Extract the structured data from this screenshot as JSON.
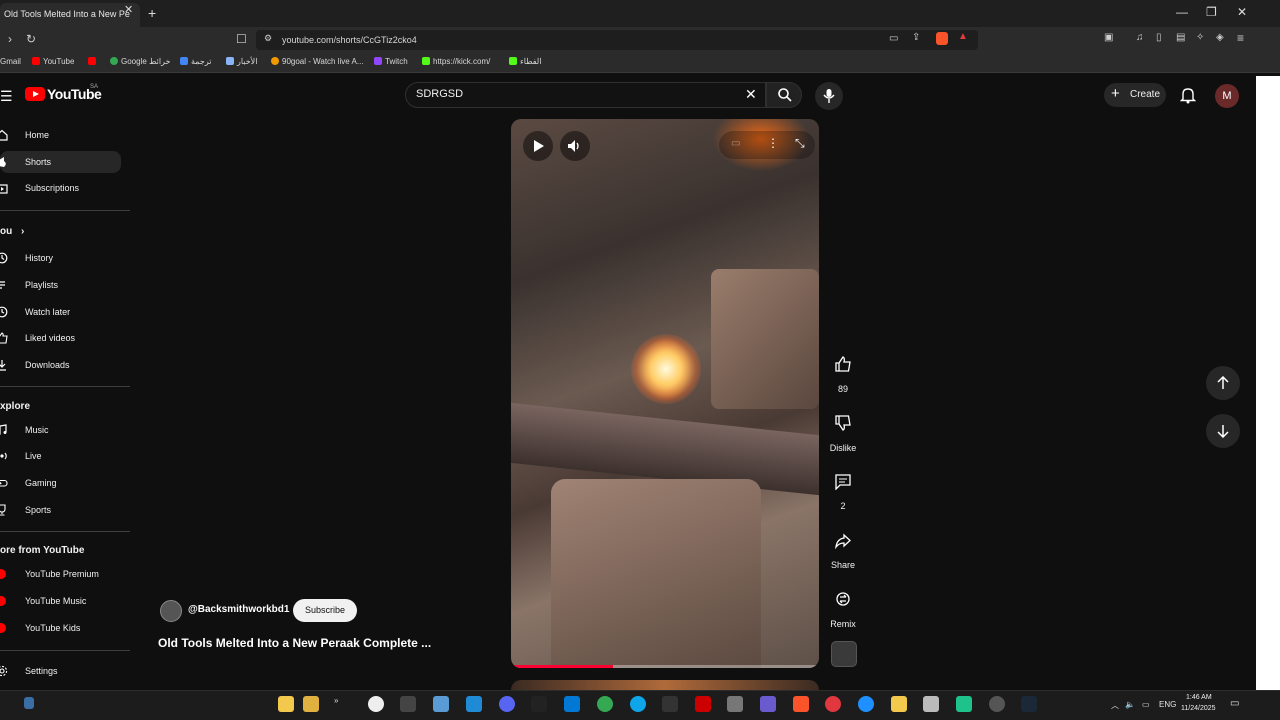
{
  "browser": {
    "tab_title": "Old Tools Melted Into a New Pe",
    "url": "youtube.com/shorts/CcGTiz2cko4",
    "bookmarks": [
      "Gmail",
      "YouTube",
      "Google خرائط",
      "ترجمة",
      "الأخبار",
      "90goal - Watch live A...",
      "Twitch",
      "https://kick.com/",
      "الفطاء"
    ]
  },
  "header": {
    "logo_text": "YouTube",
    "region": "SA",
    "search_value": "SDRGSD",
    "create_label": "Create",
    "avatar_letter": "M"
  },
  "sidebar": {
    "main": [
      "Home",
      "Shorts",
      "Subscriptions"
    ],
    "you_heading": "ou",
    "you": [
      "History",
      "Playlists",
      "Watch later",
      "Liked videos",
      "Downloads"
    ],
    "explore_heading": "xplore",
    "explore": [
      "Music",
      "Live",
      "Gaming",
      "Sports"
    ],
    "more_heading": "ore from YouTube",
    "more": [
      "YouTube Premium",
      "YouTube Music",
      "YouTube Kids"
    ],
    "settings": "Settings"
  },
  "short": {
    "channel": "@Backsmithworkbd1",
    "subscribe": "Subscribe",
    "title": "Old Tools Melted Into a New Peraak Complete ...",
    "progress": 0.33
  },
  "actions": {
    "likes": "89",
    "dislike": "Dislike",
    "comments": "2",
    "share": "Share",
    "remix": "Remix"
  },
  "taskbar": {
    "lang": "ENG",
    "time": "1:46 AM",
    "date": "11/24/2025"
  },
  "colors": {
    "brand_red": "#ff0000",
    "progress_red": "#ff0033",
    "bg": "#0f0f0f"
  }
}
